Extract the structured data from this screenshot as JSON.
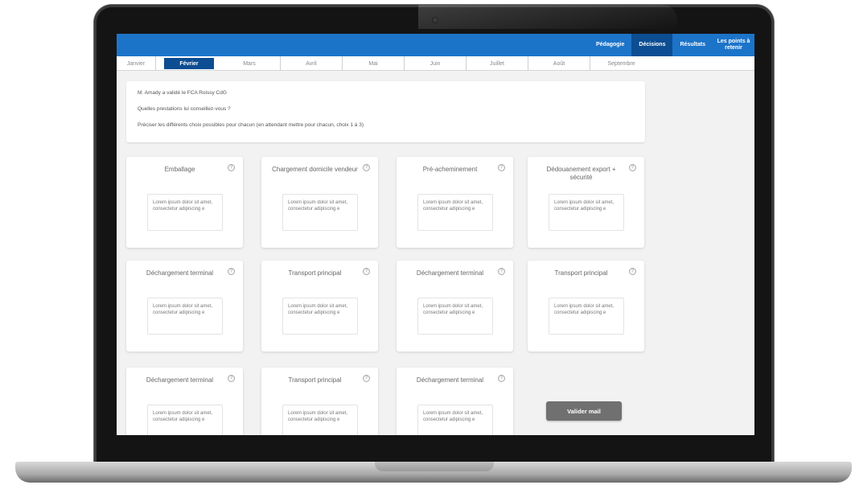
{
  "nav": {
    "items": [
      {
        "label": "Pédagogie",
        "active": false
      },
      {
        "label": "Décisions",
        "active": true
      },
      {
        "label": "Résultats",
        "active": false
      },
      {
        "label": "Les points à retenir",
        "active": false
      }
    ]
  },
  "months": [
    {
      "label": "Janvier",
      "active": false
    },
    {
      "label": "Février",
      "active": true
    },
    {
      "label": "Mars",
      "active": false
    },
    {
      "label": "Avril",
      "active": false
    },
    {
      "label": "Mai",
      "active": false
    },
    {
      "label": "Juin",
      "active": false
    },
    {
      "label": "Juillet",
      "active": false
    },
    {
      "label": "Août",
      "active": false
    },
    {
      "label": "Septembre",
      "active": false
    }
  ],
  "instructions": {
    "line1": "M. Amady a validé le FCA Roissy CdG",
    "line2": "Quelles prestations lui conseillez-vous ?",
    "line3": "Préciser les différents choix possibles pour chacun (en attendant mettre pour chacun, choix 1 à 3)"
  },
  "cards": [
    {
      "title": "Emballage",
      "text": "Lorem ipsum dolor sit amet, consectetur adipiscing e"
    },
    {
      "title": "Chargement domicile vendeur",
      "text": "Lorem ipsum dolor sit amet, consectetur adipiscing e"
    },
    {
      "title": "Pré-acheminement",
      "text": "Lorem ipsum dolor sit amet, consectetur adipiscing e"
    },
    {
      "title": "Dédouanement export + sécurité",
      "text": "Lorem ipsum dolor sit amet, consectetur adipiscing e"
    },
    {
      "title": "Déchargement terminal",
      "text": "Lorem ipsum dolor sit amet, consectetur adipiscing e"
    },
    {
      "title": "Transport principal",
      "text": "Lorem ipsum dolor sit amet, consectetur adipiscing e"
    },
    {
      "title": "Déchargement terminal",
      "text": "Lorem ipsum dolor sit amet, consectetur adipiscing e"
    },
    {
      "title": "Transport principal",
      "text": "Lorem ipsum dolor sit amet, consectetur adipiscing e"
    },
    {
      "title": "Déchargement terminal",
      "text": "Lorem ipsum dolor sit amet, consectetur adipiscing e"
    },
    {
      "title": "Transport principal",
      "text": "Lorem ipsum dolor sit amet, consectetur adipiscing e"
    },
    {
      "title": "Déchargement terminal",
      "text": "Lorem ipsum dolor sit amet, consectetur adipiscing e"
    }
  ],
  "help_icon_glyph": "?",
  "validate_label": "Valider mail",
  "colors": {
    "accent": "#1c74c9",
    "accent_dark": "#0d4d92",
    "button": "#707070"
  }
}
